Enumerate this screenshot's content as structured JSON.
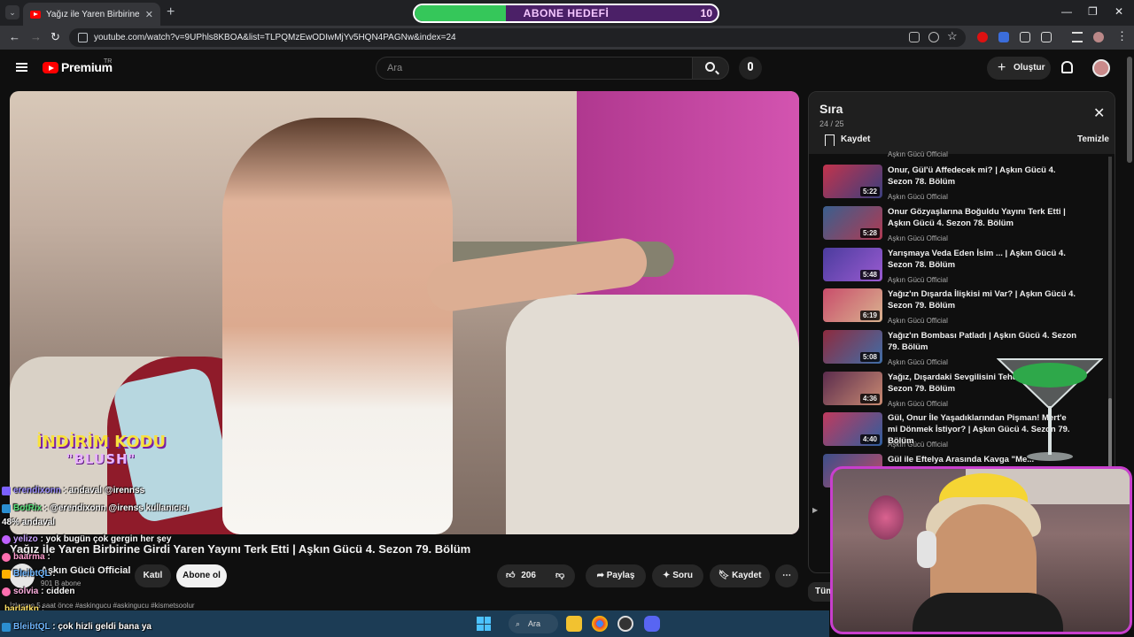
{
  "browser": {
    "tab_title": "Yağız ile Yaren Birbirine Girdi Yar",
    "tab_close": "✕",
    "new_tab": "+",
    "url": "youtube.com/watch?v=9UPhls8KBOA&list=TLPQMzEwODIwMjYv5HQN4PAGNw&index=24",
    "win_min": "—",
    "win_max": "❐",
    "win_close": "✕"
  },
  "sub_goal": {
    "title": "ABONE HEDEFİ",
    "count": "10",
    "progress": 0.3
  },
  "youtube": {
    "logo_text": "Premium",
    "logo_region": "TR",
    "search_placeholder": "Ara",
    "create_label": "Oluştur"
  },
  "video": {
    "title": "Yağız ile Yaren Birbirine Girdi Yaren Yayını Terk Etti | Aşkın Gücü 4. Sezon 79. Bölüm",
    "promo_line1": "İNDİRİM KODU",
    "promo_line2": "\"BLUSH\"",
    "channel_name": "Aşkın Gücü Official",
    "channel_subs": "901 B abone",
    "join_label": "Katıl",
    "subscribe_label": "Abone ol",
    "likes": "206",
    "share_label": "Paylaş",
    "ask_label": "Soru",
    "save_label": "Kaydet",
    "meta": "İzlenme 5 saat önce #askingucu #askingucu #kismetsoolur"
  },
  "chat": [
    {
      "user": "erendixonn",
      "text": ": andaval @irennss",
      "color": "#9d8fff"
    },
    {
      "user": "BotRix",
      "text": ": @erendixonn @irenss kullanıcısı",
      "color": "#58e07a"
    },
    {
      "user": "",
      "text": "48% andaval",
      "color": "#ffffff"
    },
    {
      "user": "yelizo",
      "text": ": yok bugün çok gergin her şey",
      "color": "#c9a2ff"
    },
    {
      "user": "baarma",
      "text": ":",
      "color": "#ff9ecf"
    },
    {
      "user": "BleibtQL",
      "text": ":",
      "color": "#6fb7ff"
    },
    {
      "user": "solvia",
      "text": ": cidden",
      "color": "#ffb0e0"
    },
    {
      "user": "barlatkn",
      "text": ":",
      "color": "#ffe066"
    },
    {
      "user": "BleibtQL",
      "text": ": çok hizli geldi bana ya",
      "color": "#6fb7ff"
    }
  ],
  "playlist": {
    "title": "Sıra",
    "count": "24 / 25",
    "save_label": "Kaydet",
    "clear_label": "Temizle",
    "partial_channel": "Aşkın Gücü Official",
    "items": [
      {
        "title": "Onur, Gül'ü Affedecek mi? | Aşkın Gücü 4. Sezon 78. Bölüm",
        "channel": "Aşkın Gücü Official",
        "duration": "5:22"
      },
      {
        "title": "Onur Gözyaşlarına Boğuldu Yayını Terk Etti | Aşkın Gücü 4. Sezon 78. Bölüm",
        "channel": "Aşkın Gücü Official",
        "duration": "5:28"
      },
      {
        "title": "Yarışmaya Veda Eden İsim ... | Aşkın Gücü 4. Sezon 78. Bölüm",
        "channel": "Aşkın Gücü Official",
        "duration": "5:48"
      },
      {
        "title": "Yağız'ın Dışarda İlişkisi mi Var? | Aşkın Gücü 4. Sezon 79. Bölüm",
        "channel": "Aşkın Gücü Official",
        "duration": "6:19"
      },
      {
        "title": "Yağız'ın Bombası Patladı | Aşkın Gücü 4. Sezon 79. Bölüm",
        "channel": "Aşkın Gücü Official",
        "duration": "5:08"
      },
      {
        "title": "Yağız, Dışardaki Sevgilisini Tehdit... Gücü 4. Sezon 79. Bölüm",
        "channel": "Aşkın Gücü Official",
        "duration": "4:36"
      },
      {
        "title": "Gül, Onur İle Yaşadıklarından Pişman! Mert'e mi Dönmek İstiyor? | Aşkın Gücü 4. Sezon 79. Bölüm",
        "channel": "Aşkın Gücü Official",
        "duration": "4:40"
      },
      {
        "title": "Gül ile Eftelya Arasında Kavga \"Me...",
        "channel": "",
        "duration": ""
      }
    ],
    "partial_tab": "Tüm"
  },
  "taskbar": {
    "search_label": "Ara"
  },
  "colors": {
    "youtube_red": "#ff0000",
    "sub_goal_green": "#35c75a",
    "webcam_border": "#c83fcd"
  }
}
